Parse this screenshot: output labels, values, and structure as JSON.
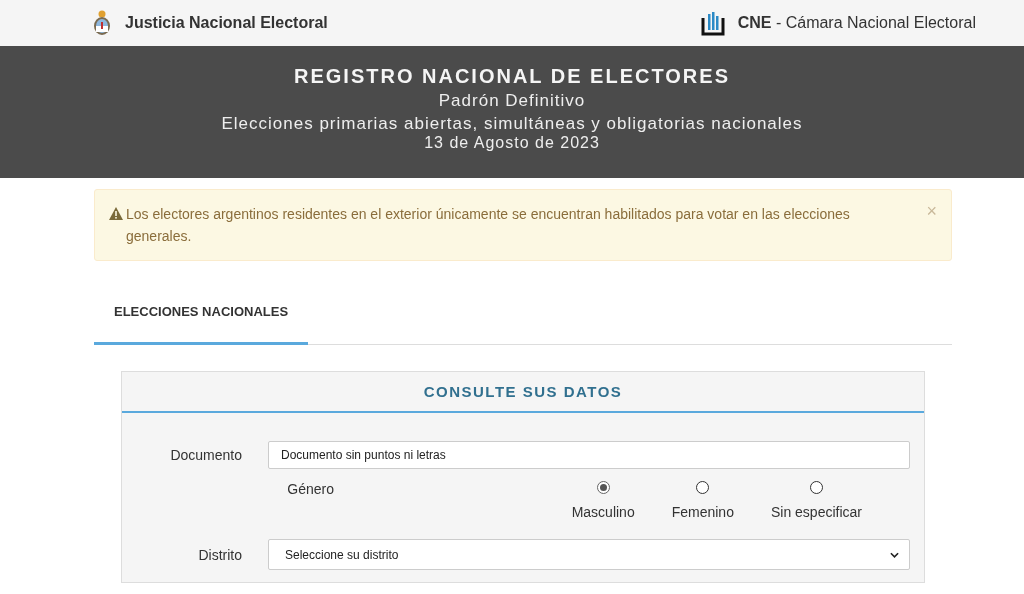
{
  "header": {
    "left_title": "Justicia Nacional Electoral",
    "right_abbr": "CNE",
    "right_title": "- Cámara Nacional Electoral"
  },
  "banner": {
    "title": "REGISTRO NACIONAL DE ELECTORES",
    "subtitle": "Padrón Definitivo",
    "election": "Elecciones primarias abiertas, simultáneas y obligatorias nacionales",
    "date": "13 de Agosto de 2023"
  },
  "alert": {
    "text": "Los electores argentinos residentes en el exterior únicamente se encuentran habilitados para votar en las elecciones generales.",
    "close": "×"
  },
  "tabs": [
    {
      "label": "ELECCIONES NACIONALES",
      "selected": true
    }
  ],
  "form": {
    "title": "CONSULTE SUS DATOS",
    "document": {
      "label": "Documento",
      "placeholder": "Documento sin puntos ni letras"
    },
    "gender": {
      "label": "Género",
      "options": [
        {
          "label": "Masculino",
          "selected": true
        },
        {
          "label": "Femenino",
          "selected": false
        },
        {
          "label": "Sin especificar",
          "selected": false
        }
      ]
    },
    "district": {
      "label": "Distrito",
      "value": "Seleccione su distrito"
    }
  }
}
